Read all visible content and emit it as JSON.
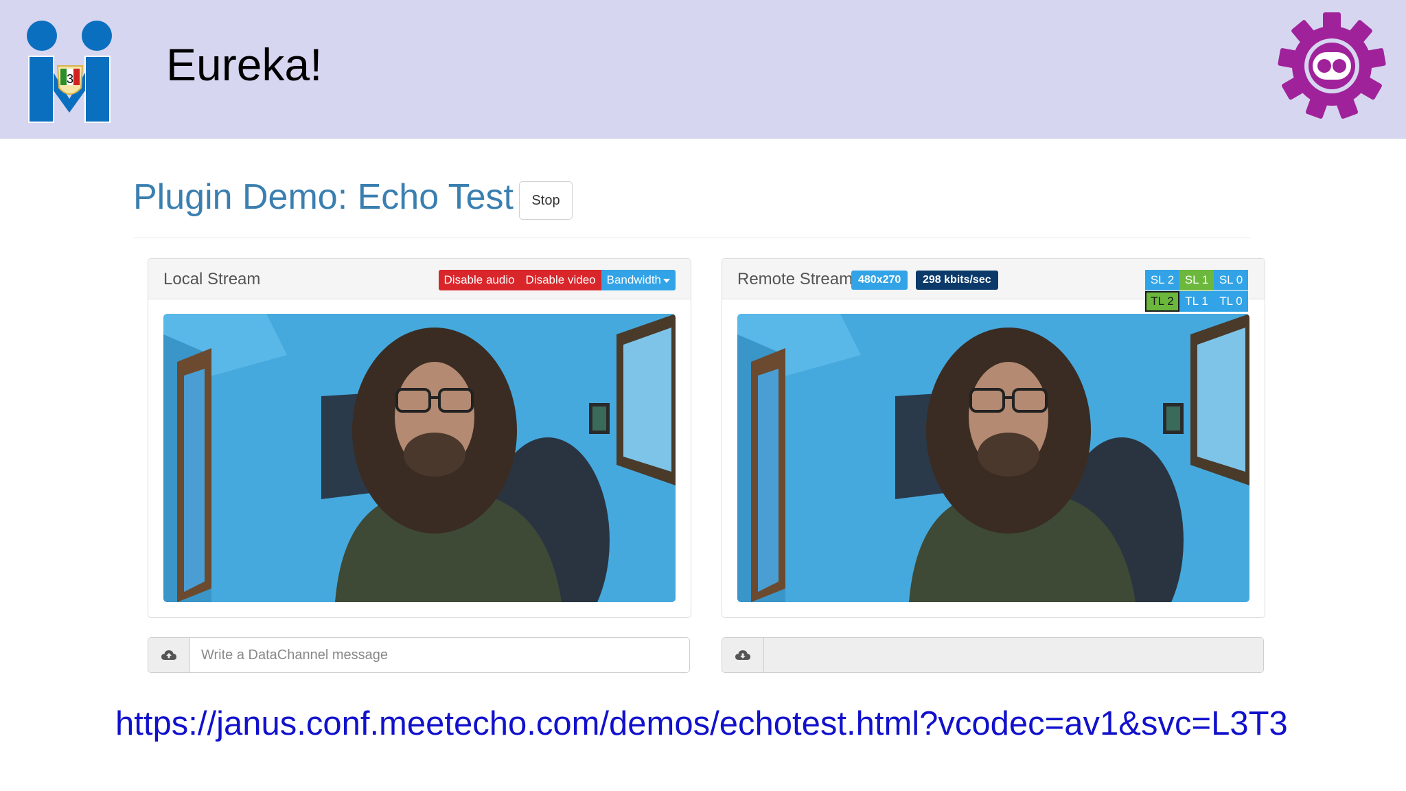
{
  "header": {
    "title": "Eureka!",
    "logo_left": {
      "icon": "meetecho-logo-icon",
      "badge": "3"
    },
    "logo_right": {
      "icon": "janus-gear-logo-icon",
      "color": "#a0229a"
    }
  },
  "page": {
    "heading": "Plugin Demo: Echo Test",
    "stop_label": "Stop"
  },
  "local_panel": {
    "title": "Local Stream",
    "buttons": {
      "disable_audio": "Disable audio",
      "disable_video": "Disable video",
      "bandwidth": "Bandwidth"
    }
  },
  "remote_panel": {
    "title": "Remote Stream",
    "resolution": "480x270",
    "bitrate": "298 kbits/sec",
    "spatial_layers": [
      "SL 2",
      "SL 1",
      "SL 0"
    ],
    "temporal_layers": [
      "TL 2",
      "TL 1",
      "TL 0"
    ],
    "selected_spatial": "SL 1",
    "selected_temporal": "TL 2"
  },
  "datachannel": {
    "send_placeholder": "Write a DataChannel message",
    "receive_value": ""
  },
  "footer": {
    "url": "https://janus.conf.meetecho.com/demos/echotest.html?vcodec=av1&svc=L3T3"
  },
  "colors": {
    "header_bg": "#d6d6f0",
    "heading": "#3a7fb0",
    "danger": "#d9262b",
    "info": "#32a3e6",
    "success": "#6cb83d",
    "primary_dark": "#0b3a6a",
    "link": "#1111cc"
  }
}
